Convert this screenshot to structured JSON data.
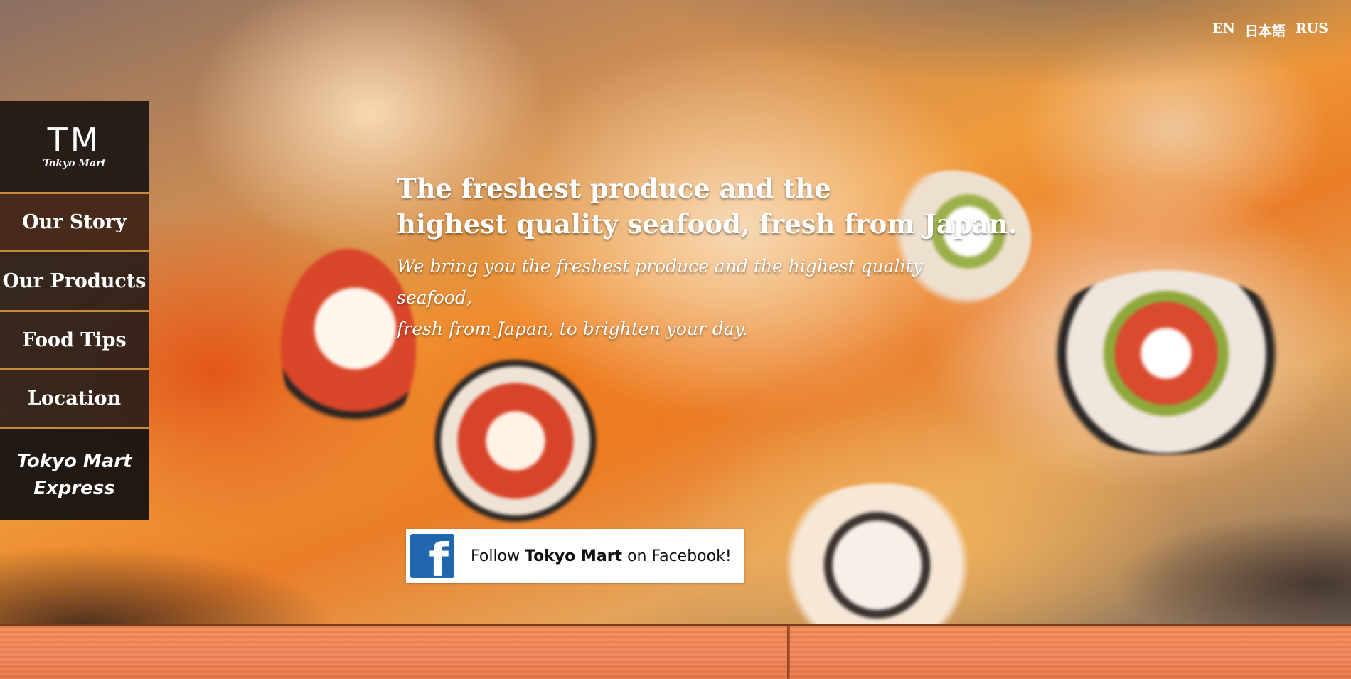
{
  "language_switch": {
    "items": [
      "EN",
      "日本語",
      "RUS"
    ]
  },
  "nav": {
    "logo": {
      "mark": "TM",
      "name": "Tokyo Mart"
    },
    "items": [
      {
        "label": "Our Story"
      },
      {
        "label": "Our Products"
      },
      {
        "label": "Food Tips"
      },
      {
        "label": "Location"
      }
    ],
    "express": {
      "line1": "Tokyo Mart",
      "line2": "Express"
    }
  },
  "hero": {
    "headline_line1": "The freshest produce and the",
    "headline_line2": "highest quality seafood, fresh from Japan.",
    "tagline_line1": "We bring you the freshest produce and the highest quality seafood,",
    "tagline_line2": "fresh from Japan, to brighten your day."
  },
  "facebook": {
    "icon": "facebook-f-icon",
    "icon_glyph": "f",
    "prefix": "Follow ",
    "brand": "Tokyo Mart",
    "suffix": " on Facebook!",
    "brand_color": "#2266b0"
  }
}
